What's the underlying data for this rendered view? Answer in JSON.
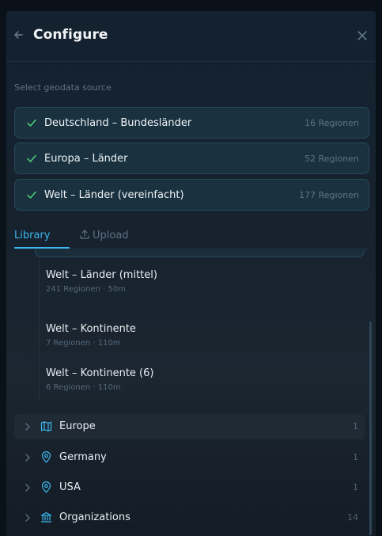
{
  "header": {
    "title": "Configure"
  },
  "sources": {
    "label": "Select geodata source",
    "items": [
      {
        "name": "Deutschland – Bundesländer",
        "count": "16 Regionen"
      },
      {
        "name": "Europa – Länder",
        "count": "52 Regionen"
      },
      {
        "name": "Welt – Länder (vereinfacht)",
        "count": "177 Regionen"
      }
    ]
  },
  "tabs": {
    "library": "Library",
    "upload": "Upload"
  },
  "library": {
    "items": [
      {
        "name": "Welt – Länder (mittel)",
        "meta": "241 Regionen · 50m"
      },
      {
        "name": "Welt – Kontinente",
        "meta": "7 Regionen · 110m"
      },
      {
        "name": "Welt – Kontinente (6)",
        "meta": "6 Regionen · 110m"
      }
    ],
    "folders": [
      {
        "name": "Europe",
        "count": "1",
        "icon": "map-icon"
      },
      {
        "name": "Germany",
        "count": "1",
        "icon": "pin-icon"
      },
      {
        "name": "USA",
        "count": "1",
        "icon": "pin-icon"
      },
      {
        "name": "Organizations",
        "count": "14",
        "icon": "bank-icon"
      }
    ]
  },
  "colors": {
    "accent": "#3bb7ef",
    "check": "#4fd27a",
    "panel": "#16222e"
  }
}
